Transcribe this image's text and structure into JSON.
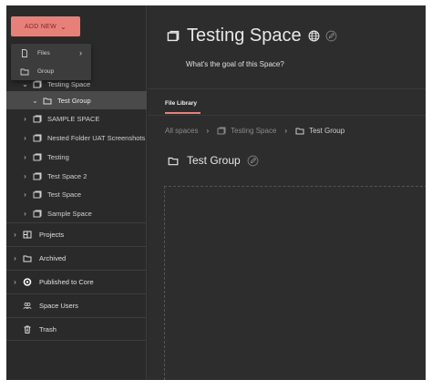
{
  "sidebar": {
    "add_new_label": "ADD NEW",
    "add_new_menu": [
      {
        "label": "Files",
        "icon": "file-icon"
      },
      {
        "label": "Group",
        "icon": "folder-icon"
      }
    ],
    "tree": [
      {
        "label": "Testing Space",
        "icon": "space-icon",
        "expanded": true
      },
      {
        "label": "Test Group",
        "icon": "folder-icon",
        "expanded": true,
        "selected": true
      },
      {
        "label": "SAMPLE SPACE",
        "icon": "space-icon"
      },
      {
        "label": "Nested Folder UAT Screenshots",
        "icon": "space-icon"
      },
      {
        "label": "Testing",
        "icon": "space-icon"
      },
      {
        "label": "Test Space 2",
        "icon": "space-icon"
      },
      {
        "label": "Test Space",
        "icon": "space-icon"
      },
      {
        "label": "Sample Space",
        "icon": "space-icon"
      }
    ],
    "sections": [
      {
        "label": "Projects",
        "icon": "projects-icon"
      },
      {
        "label": "Archived",
        "icon": "archive-icon"
      },
      {
        "label": "Published to Core",
        "icon": "core-icon"
      },
      {
        "label": "Space Users",
        "icon": "users-icon"
      },
      {
        "label": "Trash",
        "icon": "trash-icon"
      }
    ]
  },
  "header": {
    "title": "Testing Space",
    "subtitle": "What's the goal of this Space?"
  },
  "tabs": {
    "active": "File Library"
  },
  "breadcrumb": {
    "root": "All spaces",
    "space": "Testing Space",
    "group": "Test Group"
  },
  "content": {
    "group_title": "Test Group"
  },
  "colors": {
    "accent": "#e8807a",
    "background": "#2a2a2a"
  }
}
